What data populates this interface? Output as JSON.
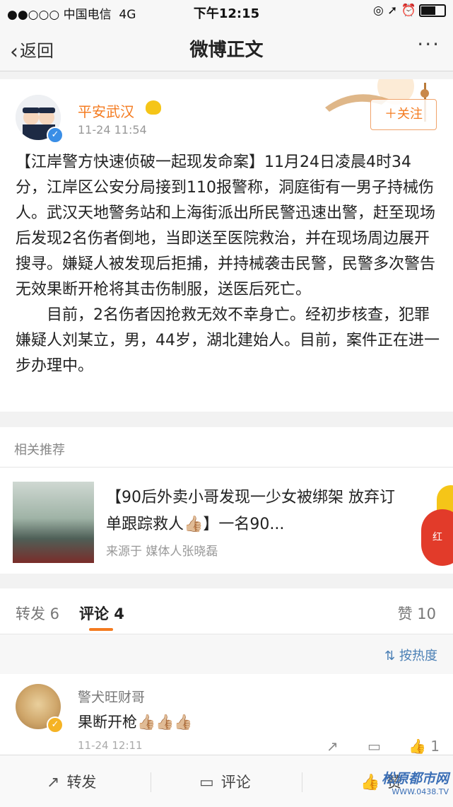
{
  "status_bar": {
    "carrier": "●●○○○ 中国电信",
    "network": "4G",
    "time": "下午12:15",
    "indicators": "◎ ➚ ⏰"
  },
  "nav": {
    "back_label": "返回",
    "title": "微博正文",
    "more": "···"
  },
  "post": {
    "author": "平安武汉",
    "time": "11-24 11:54",
    "follow_label": "＋关注",
    "paragraph1": "【江岸警方快速侦破一起现发命案】11月24日凌晨4时34分，江岸区公安分局接到110报警称，洞庭街有一男子持械伤人。武汉天地警务站和上海街派出所民警迅速出警，赶至现场后发现2名伤者倒地，当即送至医院救治，并在现场周边展开搜寻。嫌疑人被发现后拒捕，并持械袭击民警，民警多次警告无效果断开枪将其击伤制服，送医后死亡。",
    "paragraph2": "目前，2名伤者因抢救无效不幸身亡。经初步核查，犯罪嫌疑人刘某立，男，44岁，湖北建始人。目前，案件正在进一步办理中。"
  },
  "related": {
    "header": "相关推荐",
    "title": "【90后外卖小哥发现一少女被绑架 放弃订单跟踪救人👍🏼】一名90...",
    "source": "来源于 媒体人张晓磊",
    "badge": "红"
  },
  "tabs": {
    "reposts": "转发 6",
    "comments": "评论 4",
    "likes": "赞 10",
    "sort_label": "按热度"
  },
  "comment": {
    "user": "警犬旺财哥",
    "text": "果断开枪👍🏼👍🏼👍🏼",
    "time": "11-24 12:11",
    "like_count": "1"
  },
  "bottom_bar": {
    "repost": "转发",
    "comment": "评论",
    "like": "赞"
  },
  "watermark": {
    "title": "松原都市网",
    "url": "WWW.0438.TV"
  },
  "colors": {
    "accent": "#f47b20",
    "link": "#4a7fb5",
    "verified": "#3a8ee6"
  }
}
